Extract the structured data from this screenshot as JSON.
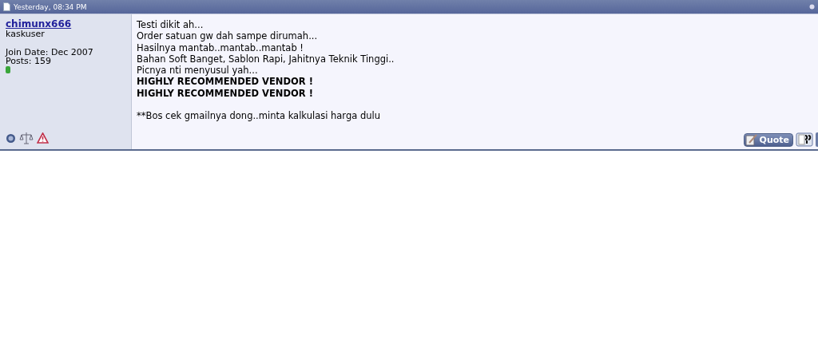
{
  "post": {
    "date": "Yesterday, 08:34 PM",
    "user": {
      "name": "chimunx666",
      "title": "kaskuser",
      "join_date": "Join Date: Dec 2007",
      "posts": "Posts: 159",
      "online": true
    },
    "message": [
      [
        "Testi dikit ah...",
        "Order satuan gw dah sampe dirumah...",
        "Hasilnya mantab..mantab..mantab !",
        "Bahan Soft Banget, Sablon Rapi, Jahitnya Teknik Tinggi..",
        "Picnya nti menyusul yah...",
        "**HIGHLY RECOMMENDED VENDOR !**",
        "**HIGHLY RECOMMENDED VENDOR !**"
      ],
      [
        "**Bos cek gmailnya dong..minta kalkulasi harga dulu"
      ]
    ],
    "quote_button": "Quote"
  }
}
